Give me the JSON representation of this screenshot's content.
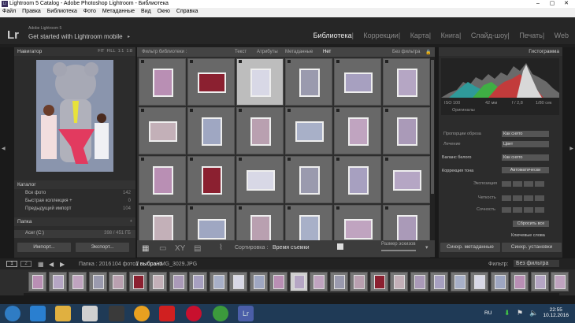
{
  "window": {
    "title": "Lightroom 5 Catalog - Adobe Photoshop Lightroom - Библиотека",
    "app_badge": "Lr"
  },
  "menu": [
    "Файл",
    "Правка",
    "Библиотека",
    "Фото",
    "Метаданные",
    "Вид",
    "Окно",
    "Справка"
  ],
  "identity": {
    "logo": "Lr",
    "product": "Adobe Lightroom 5",
    "promo": "Get started with Lightroom mobile"
  },
  "modules": [
    "Библиотека",
    "Коррекции",
    "Карта",
    "Книга",
    "Слайд-шоу",
    "Печать",
    "Web"
  ],
  "navigator": {
    "title": "Навигатор",
    "zoom": [
      "FIT",
      "FILL",
      "1:1",
      "1:8"
    ]
  },
  "catalog": {
    "title": "Каталог",
    "items": [
      {
        "label": "Все фото",
        "count": "142"
      },
      {
        "label": "Быстрая коллекция +",
        "count": "0"
      },
      {
        "label": "Предыдущий импорт",
        "count": "104"
      }
    ]
  },
  "folders": {
    "title": "Папка",
    "add": "+",
    "drive": "Acer (C:)",
    "drive_info": "398 / 451 ГБ"
  },
  "buttons": {
    "import": "Импорт...",
    "export": "Экспорт...",
    "sync_meta": "Синхр. метаданные",
    "sync_settings": "Синхр. установки"
  },
  "filter": {
    "label": "Фильтр библиотеки :",
    "tabs": [
      "Текст",
      "Атрибуты",
      "Метаданные",
      "Нет"
    ],
    "active": "Нет",
    "preset": "Без фильтра"
  },
  "toolbar": {
    "sort_label": "Сортировка :",
    "sort_value": "Время съемки",
    "thumb_size": "Размер эскизов"
  },
  "histogram": {
    "title": "Гистограмма",
    "iso": "ISO 100",
    "focal": "42 мм",
    "aperture": "f / 2,8",
    "shutter": "1/80 сек",
    "originals": "Оригиналы"
  },
  "quick_develop": {
    "crop_label": "Пропорции обреза",
    "crop_value": "Как снято",
    "treatment_label": "Лечение",
    "treatment_value": "Цвет",
    "wb_label": "Баланс белого",
    "wb_value": "Как снято",
    "tone_label": "Коррекция тона",
    "auto_tone": "Автоматически",
    "exposure": "Экспозиция",
    "clarity": "Четкость",
    "vibrance": "Сочность",
    "reset": "Сбросить все"
  },
  "keywords": {
    "title": "Ключевые слова"
  },
  "status": {
    "pages": [
      "1",
      "2"
    ],
    "path": "Папка : 2016",
    "count": "104 фото /",
    "selected": "1 выбрано",
    "file": "/ IMG_3029.JPG",
    "filter_label": "Фильтр:",
    "filter_value": "Без фильтра"
  },
  "taskbar": {
    "lang": "RU",
    "time": "22:55",
    "date": "10.12.2016"
  },
  "colors": {
    "accent": "#e8e8e8",
    "panel": "#2c2c2c",
    "taskbar": "#1f3a56"
  }
}
